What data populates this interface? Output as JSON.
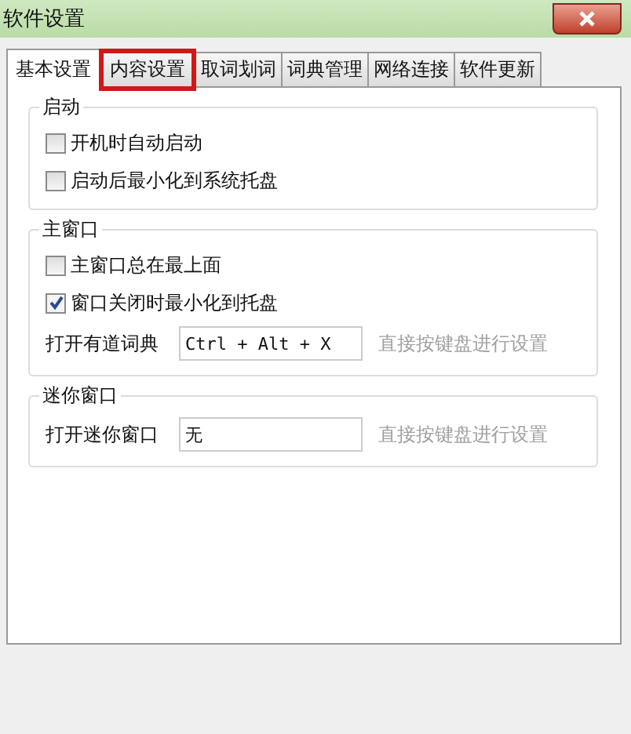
{
  "window": {
    "title": "软件设置"
  },
  "tabs": [
    {
      "label": "基本设置",
      "selected": true,
      "highlighted": false
    },
    {
      "label": "内容设置",
      "selected": false,
      "highlighted": true
    },
    {
      "label": "取词划词",
      "selected": false,
      "highlighted": false
    },
    {
      "label": "词典管理",
      "selected": false,
      "highlighted": false
    },
    {
      "label": "网络连接",
      "selected": false,
      "highlighted": false
    },
    {
      "label": "软件更新",
      "selected": false,
      "highlighted": false
    }
  ],
  "groups": [
    {
      "title": "启动",
      "rows": [
        {
          "kind": "checkbox",
          "label": "开机时自动启动",
          "checked": false
        },
        {
          "kind": "checkbox",
          "label": "启动后最小化到系统托盘",
          "checked": false
        }
      ]
    },
    {
      "title": "主窗口",
      "rows": [
        {
          "kind": "checkbox",
          "label": "主窗口总在最上面",
          "checked": false
        },
        {
          "kind": "checkbox",
          "label": "窗口关闭时最小化到托盘",
          "checked": true
        },
        {
          "kind": "hotkey",
          "label": "打开有道词典",
          "value": "Ctrl + Alt + X",
          "hint": "直接按键盘进行设置"
        }
      ]
    },
    {
      "title": "迷你窗口",
      "rows": [
        {
          "kind": "hotkey",
          "label": "打开迷你窗口",
          "value": "无",
          "hint": "直接按键盘进行设置"
        }
      ]
    }
  ]
}
